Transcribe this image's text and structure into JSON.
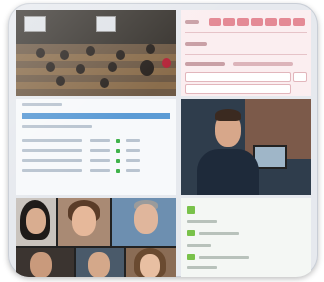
{
  "tiles": [
    {
      "id": "lecture-hall-photo",
      "kind": "photo"
    },
    {
      "id": "pink-form-screenshot",
      "kind": "screenshot"
    },
    {
      "id": "table-page-screenshot",
      "kind": "screenshot"
    },
    {
      "id": "presenter-photo",
      "kind": "photo"
    },
    {
      "id": "faces-collage",
      "kind": "photo"
    },
    {
      "id": "green-list-screenshot",
      "kind": "screenshot"
    }
  ],
  "colors": {
    "frame_bg": "#e6e9ee",
    "form_accent": "#e48a95",
    "table_header": "#5b9bd5",
    "list_accent": "#79c24a"
  }
}
